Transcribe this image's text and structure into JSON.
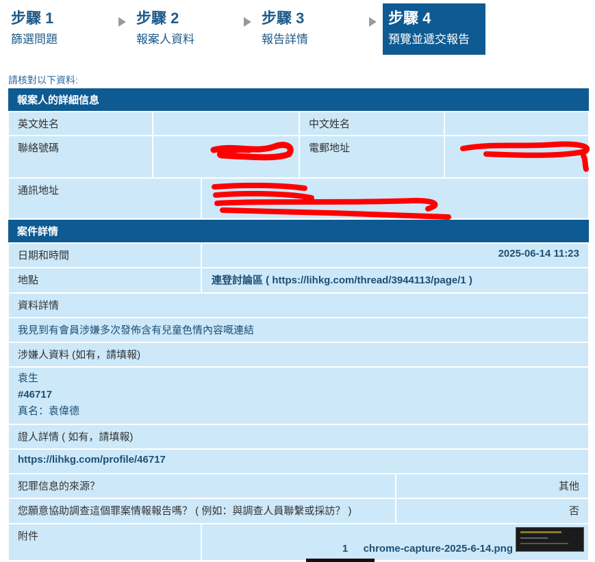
{
  "steps": [
    {
      "num": "步驟 1",
      "name": "篩選問題",
      "active": false
    },
    {
      "num": "步驟 2",
      "name": "報案人資料",
      "active": false
    },
    {
      "num": "步驟 3",
      "name": "報告詳情",
      "active": false
    },
    {
      "num": "步驟 4",
      "name": "預覽並遞交報告",
      "active": true
    }
  ],
  "intro": "請核對以下資料:",
  "reporter": {
    "heading": "報案人的詳細信息",
    "english_name_label": "英文姓名",
    "english_name_value": "",
    "chinese_name_label": "中文姓名",
    "chinese_name_value": "",
    "phone_label": "聯絡號碼",
    "email_label": "電郵地址",
    "address_label": "通訊地址"
  },
  "case": {
    "heading": "案件詳情",
    "datetime_label": "日期和時間",
    "datetime_value": "2025-06-14 11:23",
    "location_label": "地點",
    "location_value": "連登討論區 ( https://lihkg.com/thread/3944113/page/1 )",
    "details_label": "資料詳情",
    "details_value": "我見到有會員涉嫌多次發佈含有兒童色情內容嘅連結",
    "suspect_label": "涉嫌人資料 (如有，請填報)",
    "suspect_lines": [
      "袁生",
      "#46717",
      "真名：袁偉德"
    ],
    "witness_label": "證人詳情 ( 如有，請填報)",
    "witness_value": "https://lihkg.com/profile/46717",
    "source_label": "犯罪信息的來源？",
    "source_value": "其他",
    "assist_label": "您願意協助調查這個罪案情報報告嗎？ ( 例如：與調查人員聯繫或採訪？ )",
    "assist_value": "否",
    "attachment_label": "附件",
    "attachment_index": "1",
    "attachment_file": "chrome-capture-2025-6-14.png"
  },
  "colors": {
    "section_bg": "#0e5a92",
    "cell_bg": "#cde8f8",
    "redaction": "#ff0000"
  }
}
